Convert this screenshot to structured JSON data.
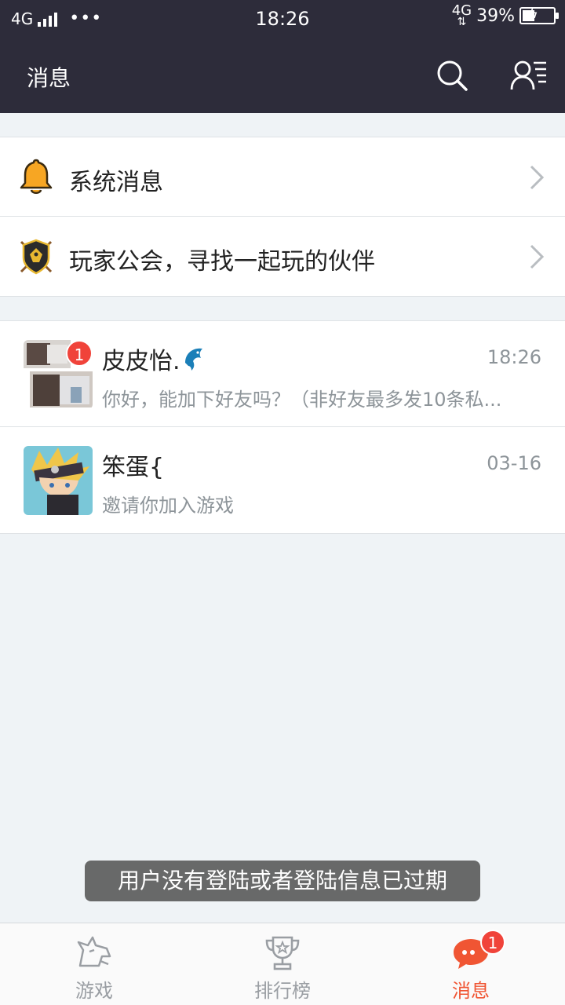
{
  "status_bar": {
    "network_left": "4G",
    "more": "•••",
    "time": "18:26",
    "network_right": "4G",
    "battery_percent": "39%",
    "battery_level": 0.39
  },
  "header": {
    "title": "消息",
    "search_icon": "search-icon",
    "contacts_icon": "contacts-icon"
  },
  "entries": {
    "system": {
      "label": "系统消息",
      "icon": "bell-icon"
    },
    "guild": {
      "label": "玩家公会，寻找一起玩的伙伴",
      "icon": "guild-shield-icon"
    }
  },
  "messages": [
    {
      "name": "皮皮怡.",
      "time": "18:26",
      "preview": "你好，能加下好友吗？（非好友最多发10条私...",
      "badge": "1",
      "name_icon": "dolphin-icon"
    },
    {
      "name": "笨蛋{",
      "time": "03-16",
      "preview": "邀请你加入游戏"
    }
  ],
  "toast": "用户没有登陆或者登陆信息已过期",
  "tabbar": {
    "tabs": [
      {
        "label": "游戏",
        "icon": "wolf-head-icon",
        "active": false
      },
      {
        "label": "排行榜",
        "icon": "trophy-icon",
        "active": false
      },
      {
        "label": "消息",
        "icon": "chat-bubble-icon",
        "active": true,
        "badge": "1"
      }
    ]
  },
  "colors": {
    "header_bg": "#2d2c3a",
    "page_bg": "#eff3f6",
    "accent": "#f05533",
    "badge": "#f0433a"
  }
}
